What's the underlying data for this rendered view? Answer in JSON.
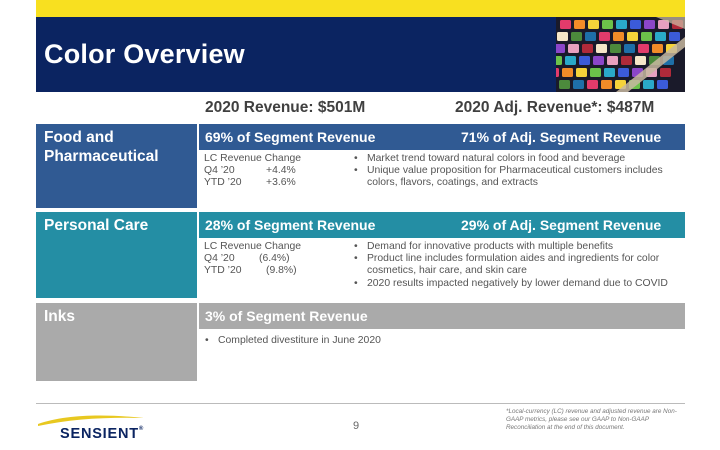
{
  "title": "Color Overview",
  "revenue_header": "2020 Revenue: $501M",
  "adj_revenue_header": "2020 Adj. Revenue*: $487M",
  "segments": [
    {
      "name": "Food and Pharmaceutical",
      "segment_pct": "69% of Segment Revenue",
      "adj_pct": "71% of Adj. Segment Revenue",
      "lc_title": "LC Revenue Change",
      "lc_rows": [
        {
          "period": "Q4 ’20",
          "value": "+4.4%"
        },
        {
          "period": "YTD ’20",
          "value": "+3.6%"
        }
      ],
      "bullets": [
        "Market trend toward natural colors in food and beverage",
        "Unique value proposition for Pharmaceutical customers includes colors, flavors, coatings, and extracts"
      ]
    },
    {
      "name": "Personal Care",
      "segment_pct": "28% of Segment Revenue",
      "adj_pct": "29% of Adj. Segment Revenue",
      "lc_title": "LC Revenue Change",
      "lc_rows": [
        {
          "period": "Q4 ’20",
          "value": "(6.4%)"
        },
        {
          "period": "YTD ’20",
          "value": "(9.8%)"
        }
      ],
      "bullets": [
        "Demand for innovative products with multiple benefits",
        "Product line includes formulation aides and ingredients for color cosmetics, hair care, and skin care",
        "2020 results impacted negatively by lower demand due to COVID"
      ]
    },
    {
      "name": "Inks",
      "segment_pct": "3% of Segment Revenue",
      "bullets": [
        "Completed divestiture in June 2020"
      ]
    }
  ],
  "footer": {
    "page_number": "9",
    "logo": "SENSIENT",
    "logo_mark": "®",
    "footnote": "*Local-currency (LC) revenue and adjusted revenue are Non-GAAP metrics, please see our GAAP to Non-GAAP Reconciliation at the end of this document."
  },
  "colors": {
    "header_navy": "#0b2461",
    "accent_yellow": "#f8e020",
    "food_blue": "#305a93",
    "personal_care_teal": "#248ea4",
    "inks_gray": "#aaaaaa"
  }
}
